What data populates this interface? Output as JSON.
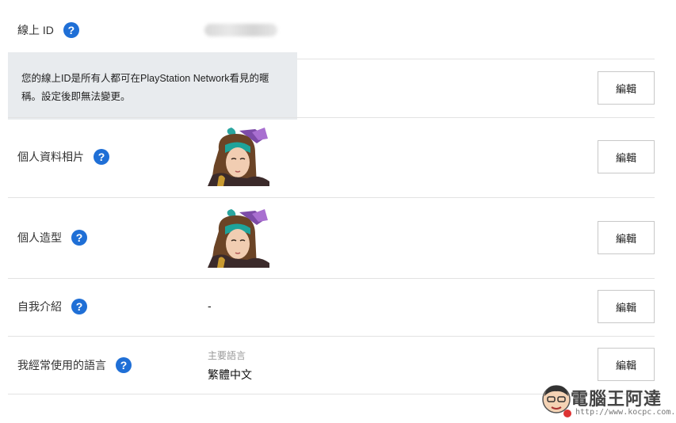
{
  "online_id": {
    "label": "線上 ID",
    "tooltip": "您的線上ID是所有人都可在PlayStation Network看見的暱稱。設定後即無法變更。"
  },
  "rows": {
    "profile_photo": {
      "label": "個人資料相片"
    },
    "avatar": {
      "label": "個人造型"
    },
    "about_me": {
      "label": "自我介紹",
      "value": "-"
    },
    "languages": {
      "label": "我經常使用的語言",
      "sub_label": "主要語言",
      "value": "繁體中文"
    }
  },
  "edit_label": "編輯",
  "watermark": {
    "title": "電腦王阿達",
    "url": "http://www.kocpc.com.tw"
  },
  "colors": {
    "help_icon": "#1f6fd6",
    "tooltip_bg": "#e8ebee",
    "divider": "#e2e2e2"
  }
}
